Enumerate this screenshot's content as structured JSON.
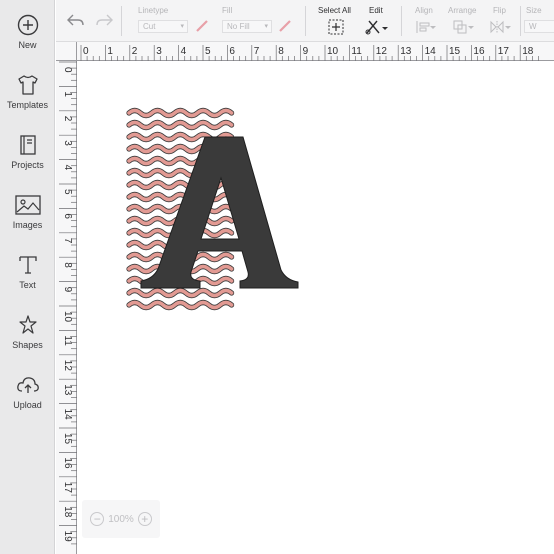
{
  "sidebar": {
    "items": [
      {
        "label": "New",
        "icon": "plus-circle-icon"
      },
      {
        "label": "Templates",
        "icon": "tshirt-icon"
      },
      {
        "label": "Projects",
        "icon": "book-icon"
      },
      {
        "label": "Images",
        "icon": "image-icon"
      },
      {
        "label": "Text",
        "icon": "text-t-icon"
      },
      {
        "label": "Shapes",
        "icon": "shapes-icon"
      },
      {
        "label": "Upload",
        "icon": "cloud-upload-icon"
      }
    ]
  },
  "toolbar": {
    "undo_icon": "undo-icon",
    "redo_icon": "redo-icon",
    "linetype_label": "Linetype",
    "linetype_value": "Cut",
    "fill_label": "Fill",
    "fill_value": "No Fill",
    "select_all_label": "Select All",
    "edit_label": "Edit",
    "align_label": "Align",
    "arrange_label": "Arrange",
    "flip_label": "Flip",
    "size_label": "Size",
    "size_w": "W"
  },
  "ruler": {
    "h_numbers": [
      "0",
      "1",
      "2",
      "3",
      "4",
      "5",
      "6",
      "7",
      "8",
      "9",
      "10",
      "11",
      "12",
      "13",
      "14",
      "15",
      "16",
      "17",
      "18"
    ],
    "v_numbers": [
      "0",
      "1",
      "2",
      "3",
      "4",
      "5",
      "6",
      "7",
      "8",
      "9",
      "10",
      "11",
      "12",
      "13",
      "14",
      "15",
      "16",
      "17",
      "18",
      "19"
    ]
  },
  "canvas": {
    "letter": "A",
    "letter_color": "#3a3a3a",
    "wave_color": "#e29a93",
    "wave_outline": "#3a3a3a"
  },
  "zoom": {
    "value": "100%",
    "minus": "−",
    "plus": "+"
  },
  "colors": {
    "sidebar_bg": "#e9e9ea",
    "toolbar_bg": "#f4f4f5",
    "accent_pink": "#e8a0a8"
  }
}
